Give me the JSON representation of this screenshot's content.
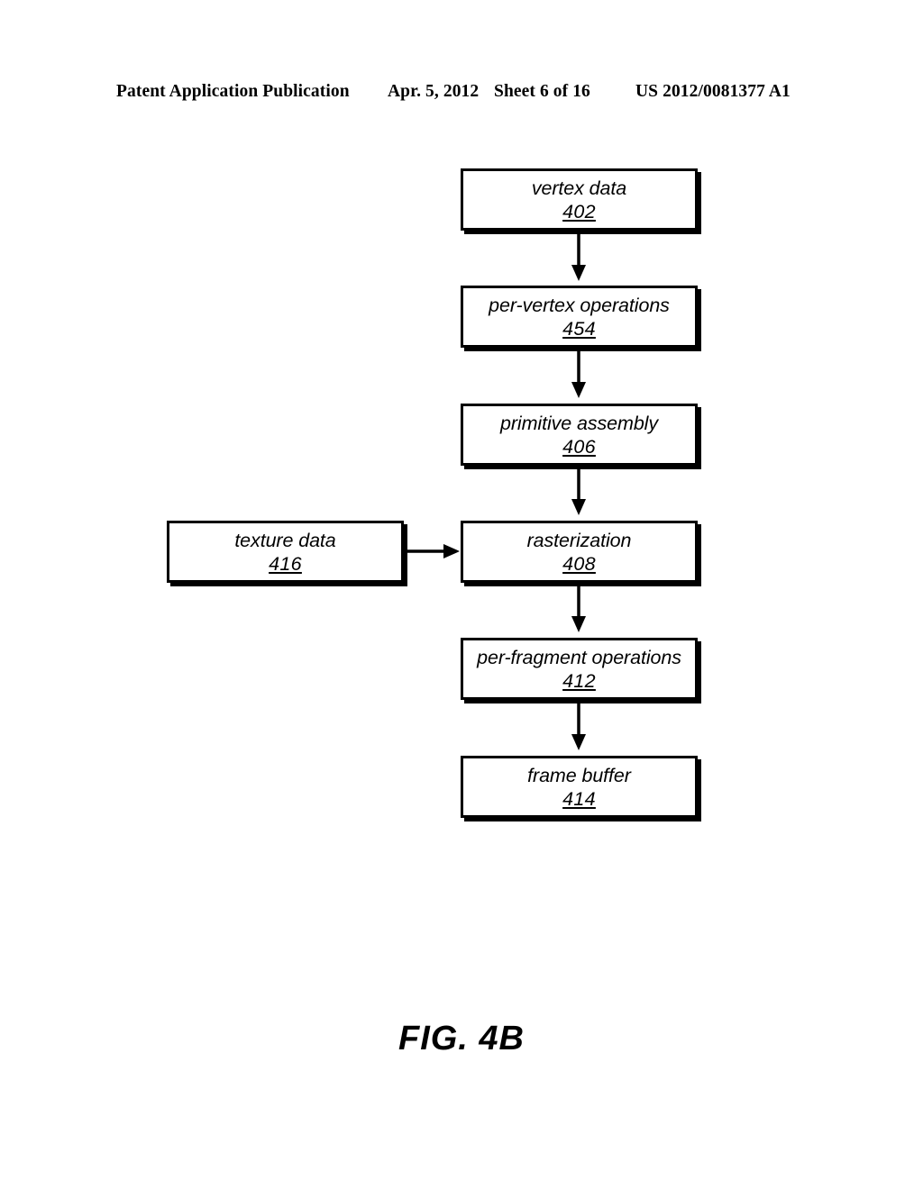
{
  "header": {
    "publication": "Patent Application Publication",
    "date": "Apr. 5, 2012",
    "sheet": "Sheet 6 of 16",
    "document_number": "US 2012/0081377 A1"
  },
  "figure": {
    "caption": "FIG. 4B",
    "type": "flowchart",
    "nodes": [
      {
        "id": "vertex-data",
        "label": "vertex data",
        "ref": "402"
      },
      {
        "id": "per-vertex-operations",
        "label": "per-vertex operations",
        "ref": "454"
      },
      {
        "id": "primitive-assembly",
        "label": "primitive assembly",
        "ref": "406"
      },
      {
        "id": "texture-data",
        "label": "texture data",
        "ref": "416"
      },
      {
        "id": "rasterization",
        "label": "rasterization",
        "ref": "408"
      },
      {
        "id": "per-fragment-operations",
        "label": "per-fragment operations",
        "ref": "412"
      },
      {
        "id": "frame-buffer",
        "label": "frame buffer",
        "ref": "414"
      }
    ],
    "edges": [
      {
        "from": "vertex-data",
        "to": "per-vertex-operations",
        "direction": "down"
      },
      {
        "from": "per-vertex-operations",
        "to": "primitive-assembly",
        "direction": "down"
      },
      {
        "from": "primitive-assembly",
        "to": "rasterization",
        "direction": "down"
      },
      {
        "from": "texture-data",
        "to": "rasterization",
        "direction": "right"
      },
      {
        "from": "rasterization",
        "to": "per-fragment-operations",
        "direction": "down"
      },
      {
        "from": "per-fragment-operations",
        "to": "frame-buffer",
        "direction": "down"
      }
    ],
    "colors": {
      "background": "#ffffff",
      "stroke": "#000000",
      "fill": "#ffffff"
    }
  }
}
